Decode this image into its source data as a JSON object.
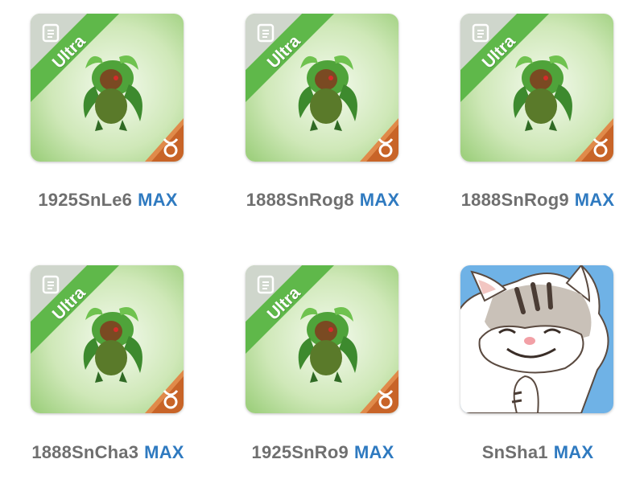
{
  "items": [
    {
      "name": "1925SnLe6",
      "badge": "MAX",
      "ribbon": "Ultra",
      "type": "monster"
    },
    {
      "name": "1888SnRog8",
      "badge": "MAX",
      "ribbon": "Ultra",
      "type": "monster"
    },
    {
      "name": "1888SnRog9",
      "badge": "MAX",
      "ribbon": "Ultra",
      "type": "monster"
    },
    {
      "name": "1888SnCha3",
      "badge": "MAX",
      "ribbon": "Ultra",
      "type": "monster"
    },
    {
      "name": "1925SnRo9",
      "badge": "MAX",
      "ribbon": "Ultra",
      "type": "monster"
    },
    {
      "name": "SnSha1",
      "badge": "MAX",
      "type": "cat"
    }
  ],
  "colors": {
    "ribbon": "#5fb84a",
    "tile_bg_light": "#eef7e6",
    "tile_bg_mid": "#9fd07f",
    "corner": "#c86428",
    "name": "#6f6f6f",
    "badge": "#2f7ac0",
    "cat_bg": "#6fb2e6"
  },
  "icons": {
    "doc": "document-icon",
    "corner": "taurus-element-icon"
  }
}
